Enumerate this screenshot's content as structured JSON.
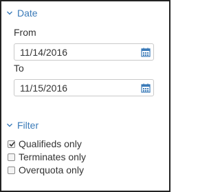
{
  "date_section": {
    "title": "Date",
    "from_label": "From",
    "from_value": "11/14/2016",
    "to_label": "To",
    "to_value": "11/15/2016"
  },
  "filter_section": {
    "title": "Filter",
    "options": [
      {
        "label": "Qualifieds only",
        "checked": true
      },
      {
        "label": "Terminates only",
        "checked": false
      },
      {
        "label": "Overquota only",
        "checked": false
      }
    ]
  },
  "colors": {
    "accent": "#3a7ab8",
    "border": "#222222",
    "text": "#333333"
  },
  "icons": {
    "section_toggle": "chevron-down-icon",
    "date_picker": "calendar-icon",
    "checked_mark": "checkmark-icon"
  }
}
